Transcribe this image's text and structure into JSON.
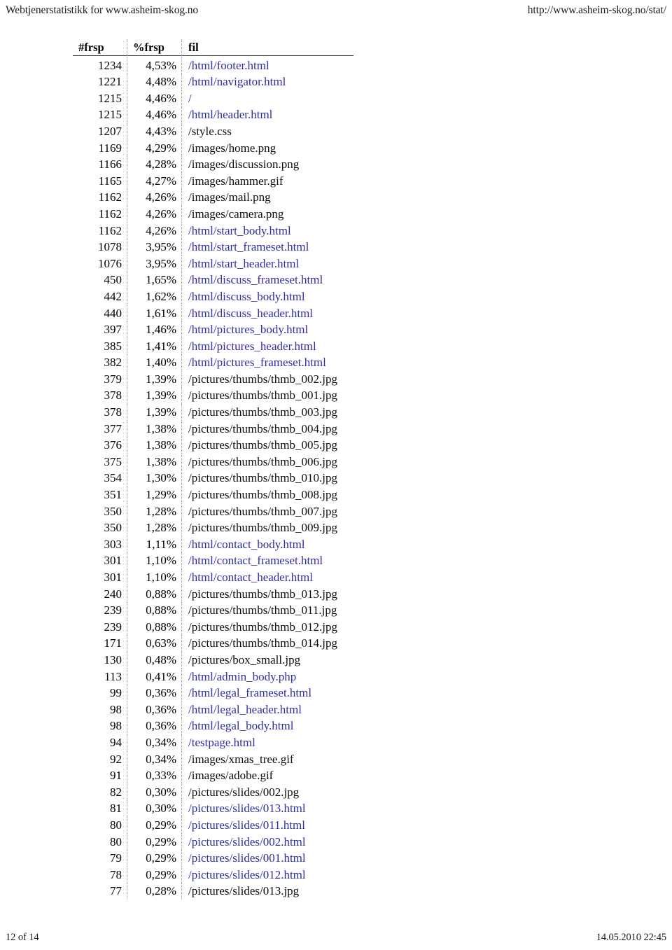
{
  "header": {
    "left_title": "Webtjenerstatistikk for www.asheim-skog.no",
    "right_url": "http://www.asheim-skog.no/stat/"
  },
  "footer": {
    "page_indicator": "12 of 14",
    "timestamp": "14.05.2010 22:45"
  },
  "colors": {
    "link": "#2e2ea4",
    "text": "#0d0d0d",
    "rule": "#3a3a3a",
    "separator": "#9a9a9a"
  },
  "table": {
    "columns": [
      {
        "key": "count",
        "label": "#frsp"
      },
      {
        "key": "percent",
        "label": "%frsp"
      },
      {
        "key": "file",
        "label": "fil"
      }
    ],
    "rows": [
      {
        "count": "1234",
        "percent": "4,53%",
        "file": "/html/footer.html",
        "link": true
      },
      {
        "count": "1221",
        "percent": "4,48%",
        "file": "/html/navigator.html",
        "link": true
      },
      {
        "count": "1215",
        "percent": "4,46%",
        "file": "/",
        "link": true
      },
      {
        "count": "1215",
        "percent": "4,46%",
        "file": "/html/header.html",
        "link": true
      },
      {
        "count": "1207",
        "percent": "4,43%",
        "file": "/style.css",
        "link": false
      },
      {
        "count": "1169",
        "percent": "4,29%",
        "file": "/images/home.png",
        "link": false
      },
      {
        "count": "1166",
        "percent": "4,28%",
        "file": "/images/discussion.png",
        "link": false
      },
      {
        "count": "1165",
        "percent": "4,27%",
        "file": "/images/hammer.gif",
        "link": false
      },
      {
        "count": "1162",
        "percent": "4,26%",
        "file": "/images/mail.png",
        "link": false
      },
      {
        "count": "1162",
        "percent": "4,26%",
        "file": "/images/camera.png",
        "link": false
      },
      {
        "count": "1162",
        "percent": "4,26%",
        "file": "/html/start_body.html",
        "link": true
      },
      {
        "count": "1078",
        "percent": "3,95%",
        "file": "/html/start_frameset.html",
        "link": true
      },
      {
        "count": "1076",
        "percent": "3,95%",
        "file": "/html/start_header.html",
        "link": true
      },
      {
        "count": "450",
        "percent": "1,65%",
        "file": "/html/discuss_frameset.html",
        "link": true
      },
      {
        "count": "442",
        "percent": "1,62%",
        "file": "/html/discuss_body.html",
        "link": true
      },
      {
        "count": "440",
        "percent": "1,61%",
        "file": "/html/discuss_header.html",
        "link": true
      },
      {
        "count": "397",
        "percent": "1,46%",
        "file": "/html/pictures_body.html",
        "link": true
      },
      {
        "count": "385",
        "percent": "1,41%",
        "file": "/html/pictures_header.html",
        "link": true
      },
      {
        "count": "382",
        "percent": "1,40%",
        "file": "/html/pictures_frameset.html",
        "link": true
      },
      {
        "count": "379",
        "percent": "1,39%",
        "file": "/pictures/thumbs/thmb_002.jpg",
        "link": false
      },
      {
        "count": "378",
        "percent": "1,39%",
        "file": "/pictures/thumbs/thmb_001.jpg",
        "link": false
      },
      {
        "count": "378",
        "percent": "1,39%",
        "file": "/pictures/thumbs/thmb_003.jpg",
        "link": false
      },
      {
        "count": "377",
        "percent": "1,38%",
        "file": "/pictures/thumbs/thmb_004.jpg",
        "link": false
      },
      {
        "count": "376",
        "percent": "1,38%",
        "file": "/pictures/thumbs/thmb_005.jpg",
        "link": false
      },
      {
        "count": "375",
        "percent": "1,38%",
        "file": "/pictures/thumbs/thmb_006.jpg",
        "link": false
      },
      {
        "count": "354",
        "percent": "1,30%",
        "file": "/pictures/thumbs/thmb_010.jpg",
        "link": false
      },
      {
        "count": "351",
        "percent": "1,29%",
        "file": "/pictures/thumbs/thmb_008.jpg",
        "link": false
      },
      {
        "count": "350",
        "percent": "1,28%",
        "file": "/pictures/thumbs/thmb_007.jpg",
        "link": false
      },
      {
        "count": "350",
        "percent": "1,28%",
        "file": "/pictures/thumbs/thmb_009.jpg",
        "link": false
      },
      {
        "count": "303",
        "percent": "1,11%",
        "file": "/html/contact_body.html",
        "link": true
      },
      {
        "count": "301",
        "percent": "1,10%",
        "file": "/html/contact_frameset.html",
        "link": true
      },
      {
        "count": "301",
        "percent": "1,10%",
        "file": "/html/contact_header.html",
        "link": true
      },
      {
        "count": "240",
        "percent": "0,88%",
        "file": "/pictures/thumbs/thmb_013.jpg",
        "link": false
      },
      {
        "count": "239",
        "percent": "0,88%",
        "file": "/pictures/thumbs/thmb_011.jpg",
        "link": false
      },
      {
        "count": "239",
        "percent": "0,88%",
        "file": "/pictures/thumbs/thmb_012.jpg",
        "link": false
      },
      {
        "count": "171",
        "percent": "0,63%",
        "file": "/pictures/thumbs/thmb_014.jpg",
        "link": false
      },
      {
        "count": "130",
        "percent": "0,48%",
        "file": "/pictures/box_small.jpg",
        "link": false
      },
      {
        "count": "113",
        "percent": "0,41%",
        "file": "/html/admin_body.php",
        "link": true
      },
      {
        "count": "99",
        "percent": "0,36%",
        "file": "/html/legal_frameset.html",
        "link": true
      },
      {
        "count": "98",
        "percent": "0,36%",
        "file": "/html/legal_header.html",
        "link": true
      },
      {
        "count": "98",
        "percent": "0,36%",
        "file": "/html/legal_body.html",
        "link": true
      },
      {
        "count": "94",
        "percent": "0,34%",
        "file": "/testpage.html",
        "link": true
      },
      {
        "count": "92",
        "percent": "0,34%",
        "file": "/images/xmas_tree.gif",
        "link": false
      },
      {
        "count": "91",
        "percent": "0,33%",
        "file": "/images/adobe.gif",
        "link": false
      },
      {
        "count": "82",
        "percent": "0,30%",
        "file": "/pictures/slides/002.jpg",
        "link": false
      },
      {
        "count": "81",
        "percent": "0,30%",
        "file": "/pictures/slides/013.html",
        "link": true
      },
      {
        "count": "80",
        "percent": "0,29%",
        "file": "/pictures/slides/011.html",
        "link": true
      },
      {
        "count": "80",
        "percent": "0,29%",
        "file": "/pictures/slides/002.html",
        "link": true
      },
      {
        "count": "79",
        "percent": "0,29%",
        "file": "/pictures/slides/001.html",
        "link": true
      },
      {
        "count": "78",
        "percent": "0,29%",
        "file": "/pictures/slides/012.html",
        "link": true
      },
      {
        "count": "77",
        "percent": "0,28%",
        "file": "/pictures/slides/013.jpg",
        "link": false
      }
    ]
  }
}
